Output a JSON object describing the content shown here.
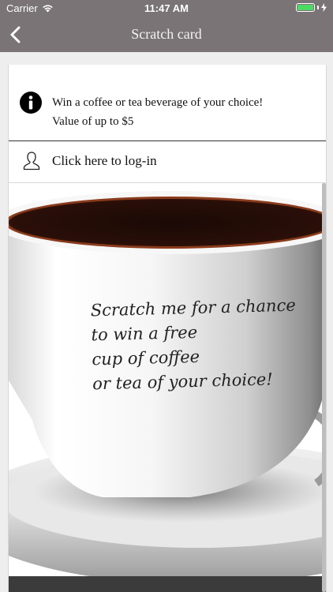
{
  "status_bar": {
    "carrier": "Carrier",
    "time": "11:47 AM"
  },
  "nav": {
    "title": "Scratch card"
  },
  "info": {
    "line1": "Win a coffee or tea beverage of your choice!",
    "line2": "Value of up to $5",
    "icon": "info-icon"
  },
  "login": {
    "label": "Click here to log-in",
    "icon": "person-icon"
  },
  "scratch": {
    "lines": [
      "Scratch me for a chance",
      "to win a free",
      "cup of coffee",
      "or tea of your choice!"
    ]
  },
  "colors": {
    "bar": "#7a7477",
    "battery": "#4cd964",
    "coffee": "#3a1a0e"
  }
}
